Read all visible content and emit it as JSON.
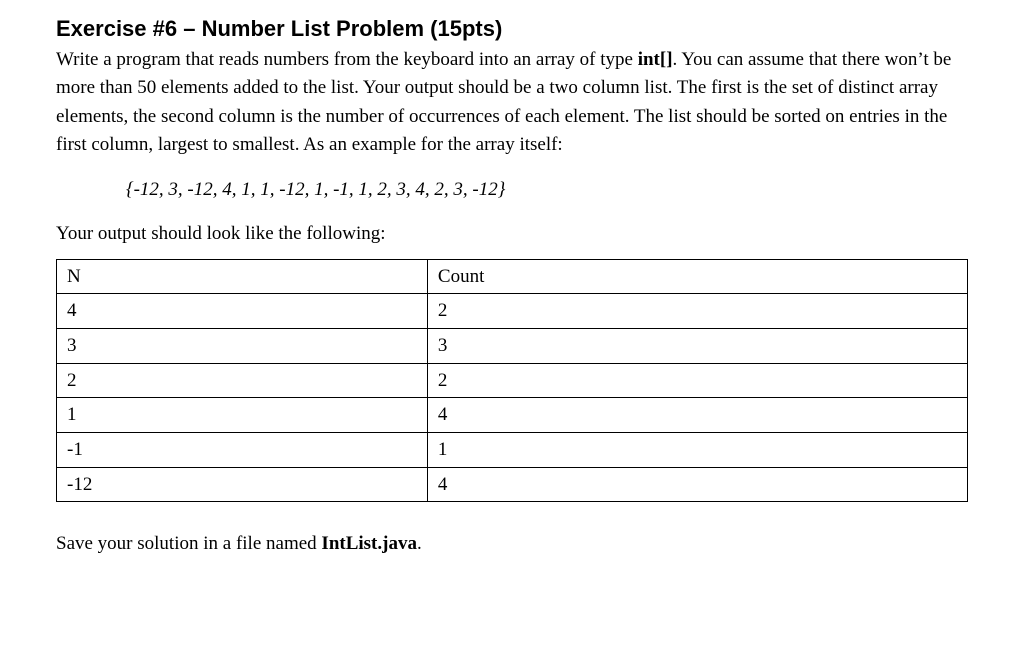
{
  "heading": "Exercise #6 – Number List Problem (15pts)",
  "intro_parts": {
    "p1": "Write a program that reads numbers from the keyboard into an array of type ",
    "p1_bold": "int[]",
    "p1_after": ".  You can assume that there won’t be more than 50 elements added to the list.  Your output should be a two column list.  The first is the set of distinct array elements, the second column is the number of occurrences of each element.  The list should be sorted on entries in the first column, largest to smallest.  As an example for the array itself:"
  },
  "example_array": "{-12, 3, -12, 4, 1, 1, -12, 1, -1, 1, 2, 3, 4, 2, 3, -12}",
  "output_intro": "Your output should look like the following:",
  "table": {
    "headers": {
      "col1": "N",
      "col2": "Count"
    },
    "rows": [
      {
        "n": "4",
        "count": "2"
      },
      {
        "n": "3",
        "count": "3"
      },
      {
        "n": "2",
        "count": "2"
      },
      {
        "n": "1",
        "count": "4"
      },
      {
        "n": "-1",
        "count": "1"
      },
      {
        "n": "-12",
        "count": "4"
      }
    ]
  },
  "save_line": {
    "pre": "Save your solution in a file named ",
    "bold": "IntList.java",
    "post": "."
  }
}
